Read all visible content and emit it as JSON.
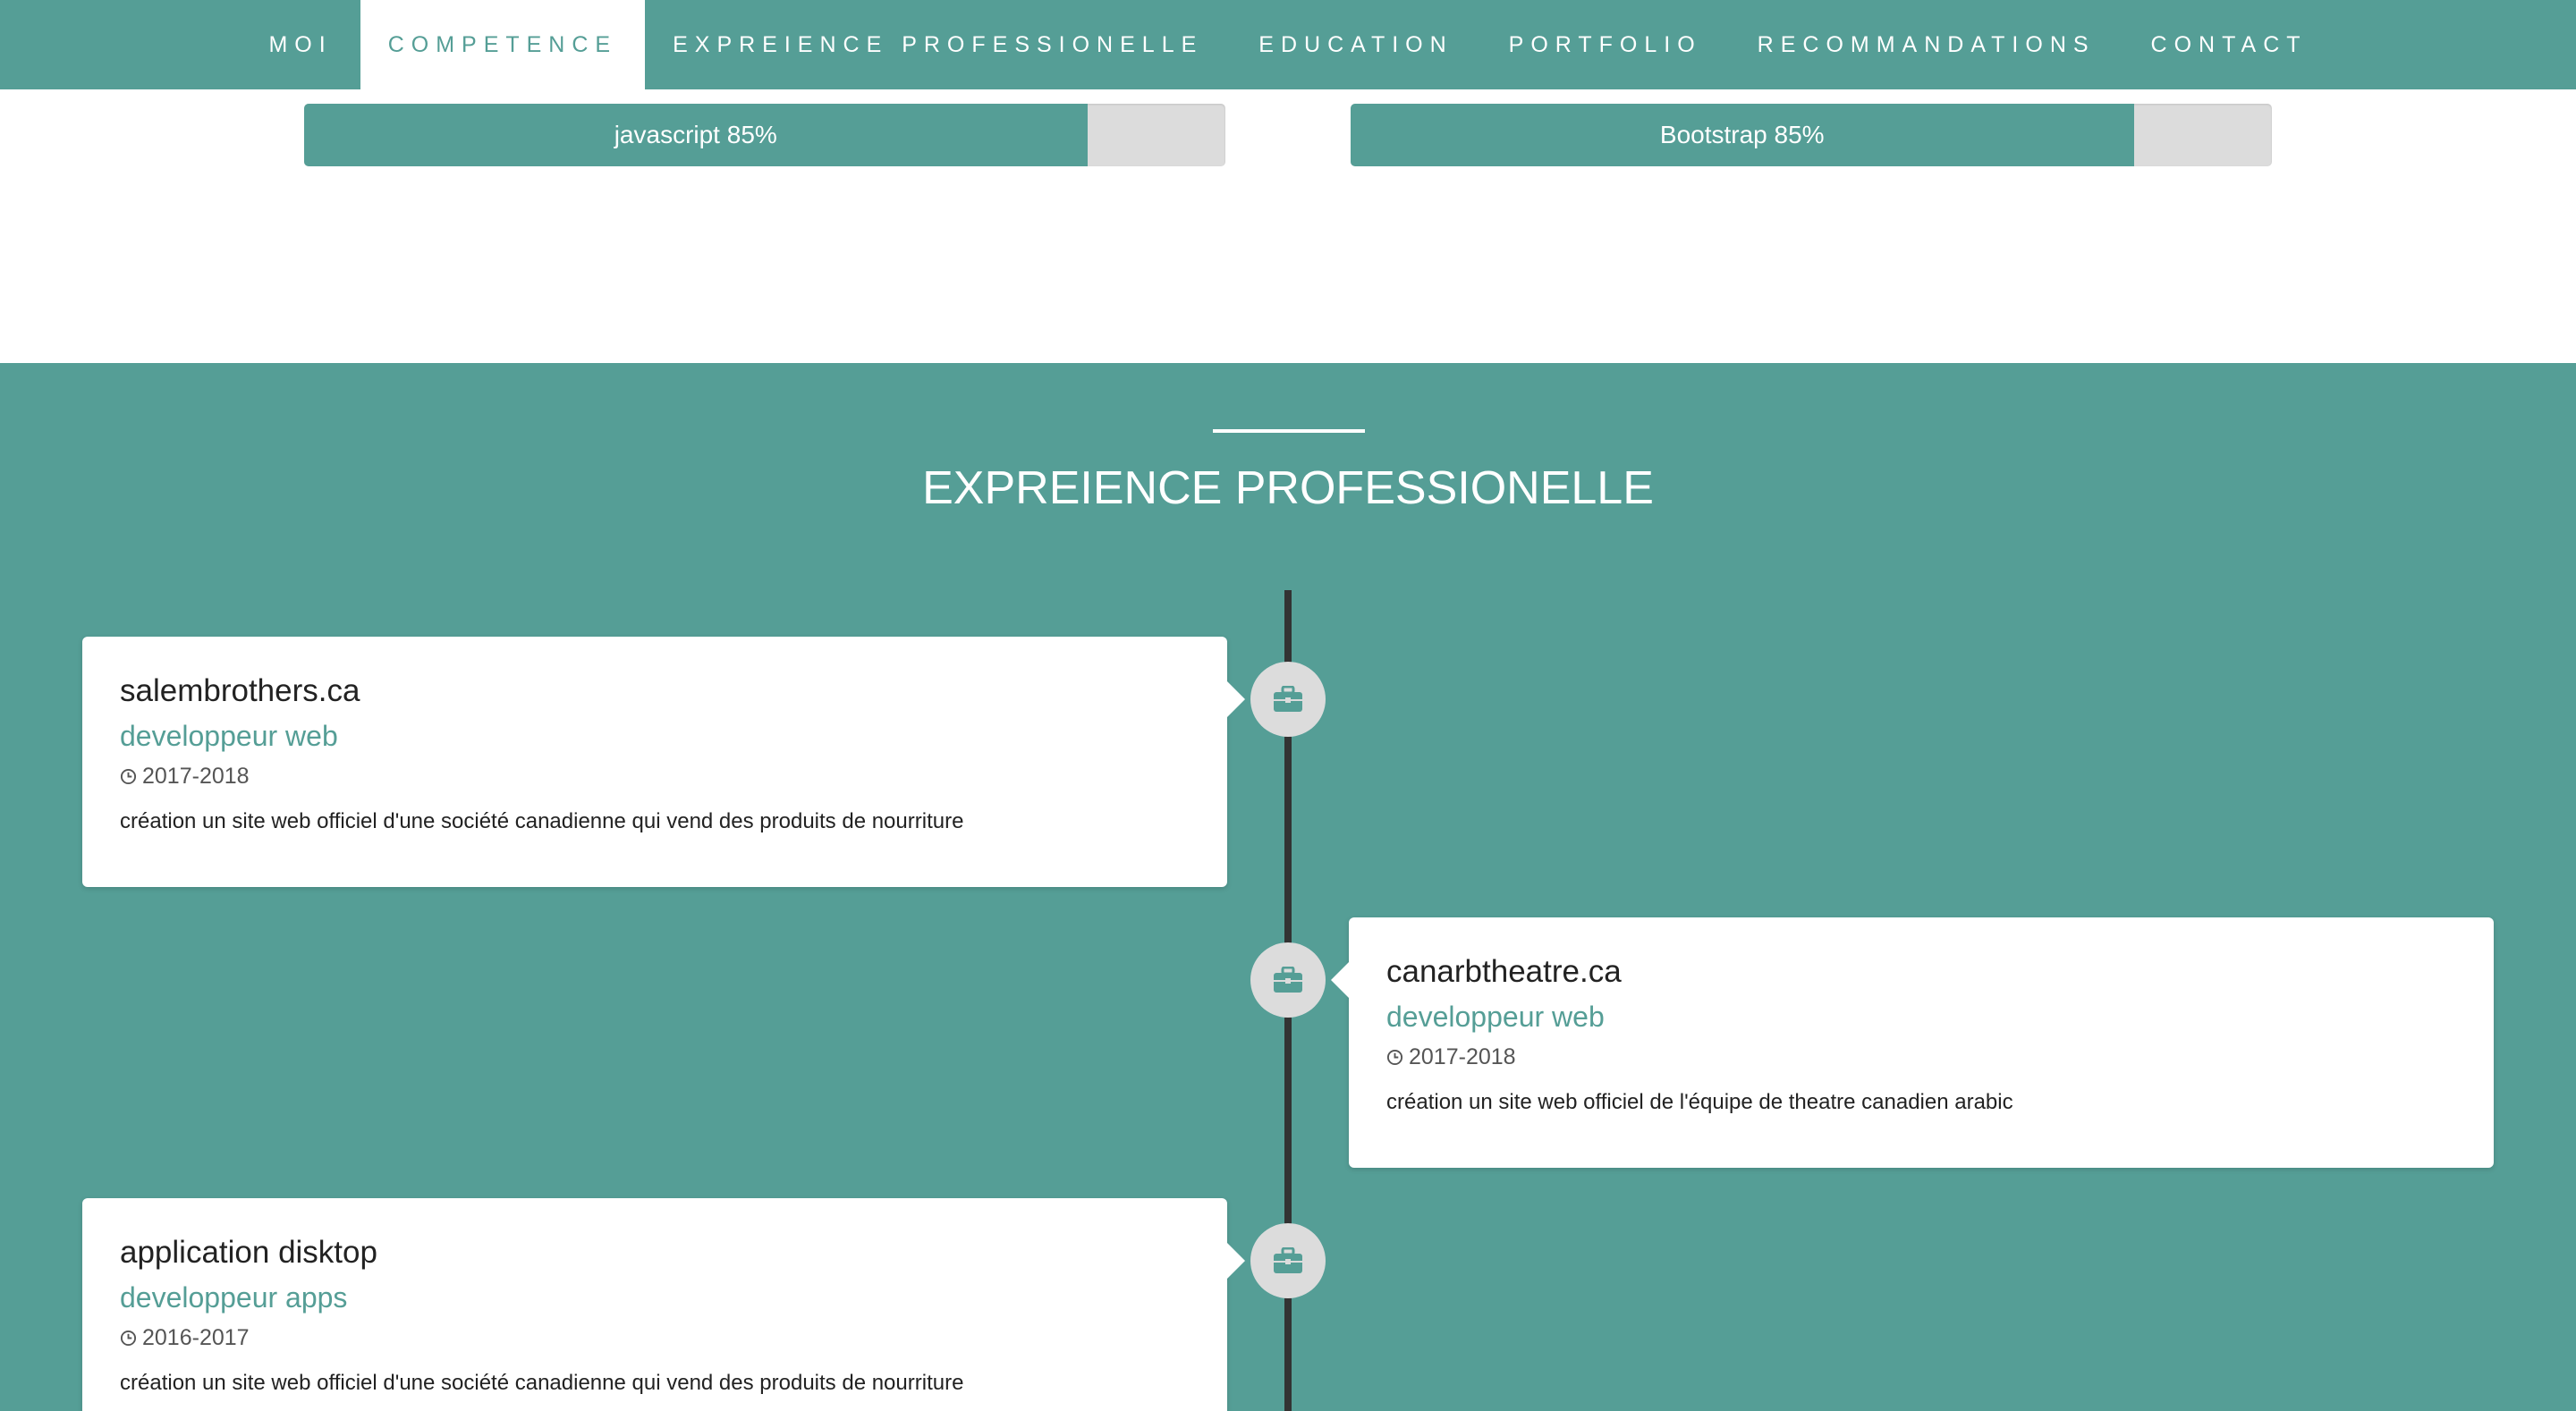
{
  "nav": {
    "items": [
      {
        "label": "MOI"
      },
      {
        "label": "COMPETENCE"
      },
      {
        "label": "EXPREIENCE PROFESSIONELLE"
      },
      {
        "label": "EDUCATION"
      },
      {
        "label": "PORTFOLIO"
      },
      {
        "label": "RECOMMANDATIONS"
      },
      {
        "label": "CONTACT"
      }
    ],
    "active": "COMPETENCE"
  },
  "skills": [
    {
      "label": "javascript 85%",
      "percent": 85
    },
    {
      "label": "Bootstrap 85%",
      "percent": 85
    }
  ],
  "experience": {
    "title": "EXPREIENCE PROFESSIONELLE",
    "items": [
      {
        "company": "salembrothers.ca",
        "role": "developpeur web",
        "date": "2017-2018",
        "description": "création un site web officiel d'une société canadienne qui vend des produits de nourriture",
        "side": "left",
        "icon": "briefcase-icon"
      },
      {
        "company": "canarbtheatre.ca",
        "role": "developpeur web",
        "date": "2017-2018",
        "description": "création un site web officiel de l'équipe de theatre canadien arabic",
        "side": "right",
        "icon": "briefcase-icon"
      },
      {
        "company": "application disktop",
        "role": "developpeur apps",
        "date": "2016-2017",
        "description": "création un site web officiel d'une société canadienne qui vend des produits de nourriture",
        "side": "left",
        "icon": "briefcase-icon"
      }
    ]
  },
  "colors": {
    "accent": "#559e96",
    "white": "#ffffff",
    "bar_track": "#dcdcdc",
    "timeline": "#333333",
    "icon_circle": "#dcdcdc"
  }
}
